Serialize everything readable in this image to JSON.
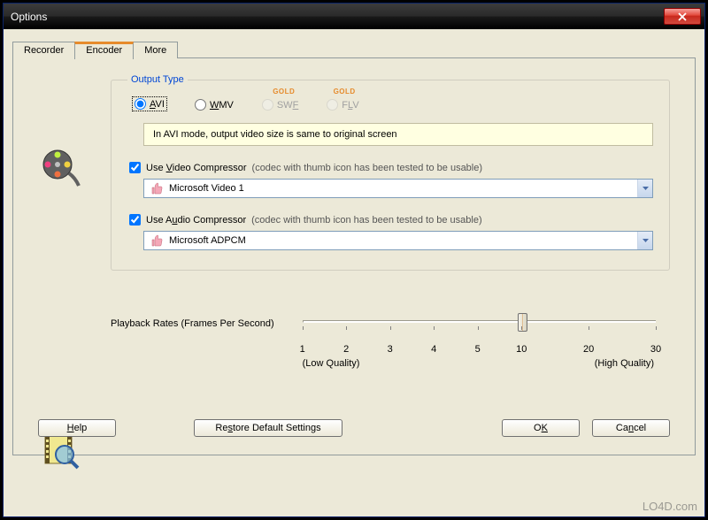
{
  "window": {
    "title": "Options"
  },
  "tabs": {
    "recorder": "Recorder",
    "encoder": "Encoder",
    "more": "More"
  },
  "output": {
    "legend": "Output Type",
    "avi": "AVI",
    "wmv": "WMV",
    "swf": "SWF",
    "flv": "FLV",
    "gold_badge": "GOLD",
    "hint": "In AVI mode, output video size is same to original screen",
    "video_compressor_label": "Use Video Compressor",
    "video_compressor_hint": "(codec with thumb icon has been tested to be usable)",
    "video_compressor_value": "Microsoft Video 1",
    "audio_compressor_label": "Use Audio Compressor",
    "audio_compressor_hint": "(codec with thumb icon has been tested to be usable)",
    "audio_compressor_value": "Microsoft ADPCM"
  },
  "playback": {
    "label": "Playback Rates (Frames Per Second)",
    "ticks": [
      "1",
      "2",
      "3",
      "4",
      "5",
      "10",
      "20",
      "30"
    ],
    "value": 10,
    "low_label": "(Low Quality)",
    "high_label": "(High Quality)"
  },
  "buttons": {
    "help": "Help",
    "restore": "Restore Default Settings",
    "ok": "OK",
    "cancel": "Cancel"
  },
  "watermark": "LO4D.com"
}
